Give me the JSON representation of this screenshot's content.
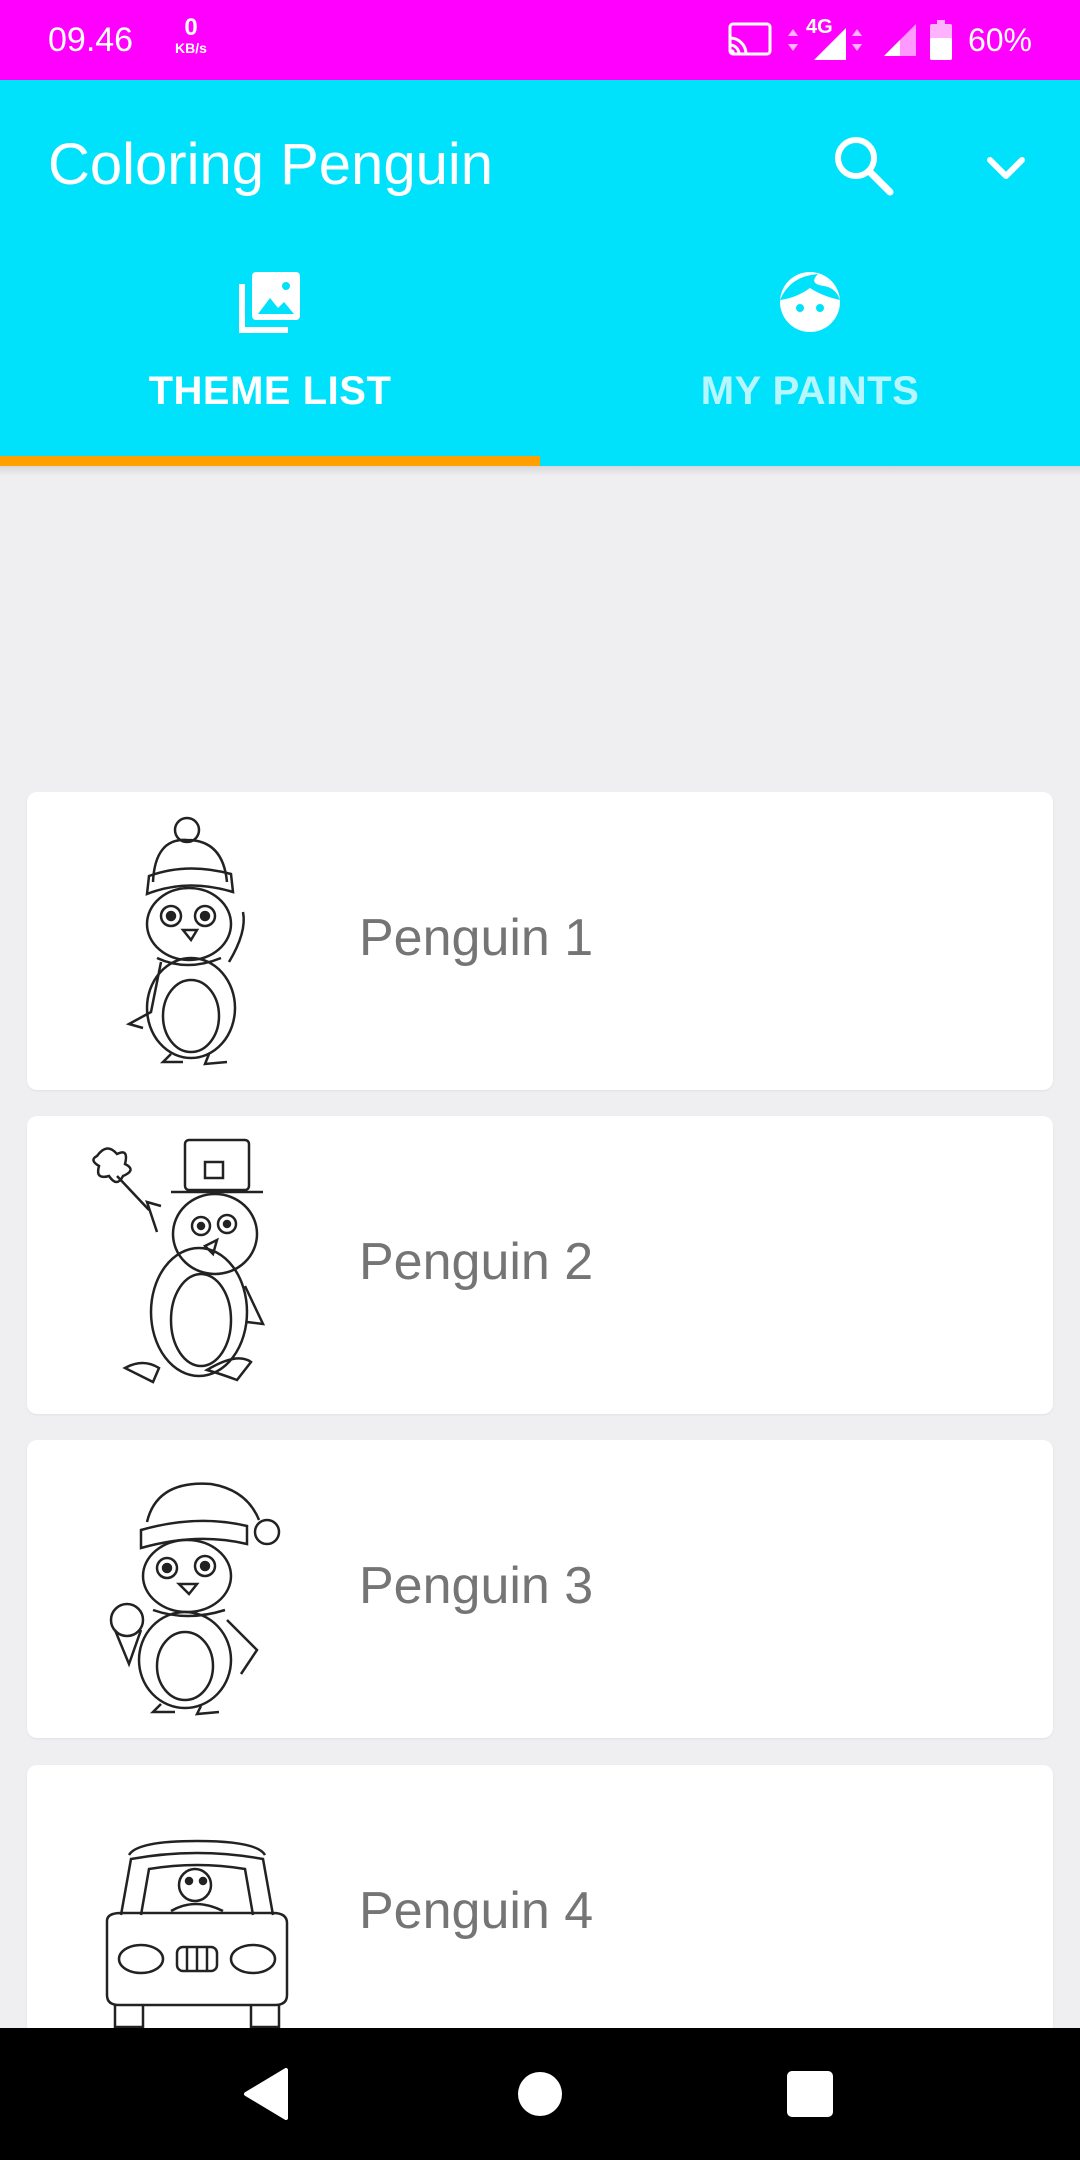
{
  "status_bar": {
    "time": "09.46",
    "speed_value": "0",
    "speed_unit": "KB/s",
    "network_type": "4G",
    "battery_percent": "60%",
    "icons": [
      "cast-icon",
      "signal-4g-icon",
      "signal-icon",
      "battery-icon"
    ]
  },
  "app_bar": {
    "title": "Coloring Penguin",
    "search_icon": "search-icon",
    "menu_icon": "chevron-down-icon"
  },
  "tabs": [
    {
      "label": "THEME LIST",
      "icon": "photo-library-icon",
      "selected": true
    },
    {
      "label": "MY PAINTS",
      "icon": "face-icon",
      "selected": false
    }
  ],
  "themes": [
    {
      "label": "Penguin 1",
      "thumbnail": "penguin-winter-hat-icon"
    },
    {
      "label": "Penguin 2",
      "thumbnail": "penguin-top-hat-icon"
    },
    {
      "label": "Penguin 3",
      "thumbnail": "penguin-ice-cream-icon"
    },
    {
      "label": "Penguin 4",
      "thumbnail": "penguin-car-icon"
    }
  ],
  "colors": {
    "status_bar": "#ff00ff",
    "app_bar": "#00e1fb",
    "tab_indicator": "#ffa000",
    "background": "#efeef0",
    "card": "#ffffff",
    "card_text": "#757575",
    "nav_bar": "#000000"
  },
  "nav_bar": {
    "buttons": [
      "back-icon",
      "home-icon",
      "recents-icon"
    ]
  }
}
